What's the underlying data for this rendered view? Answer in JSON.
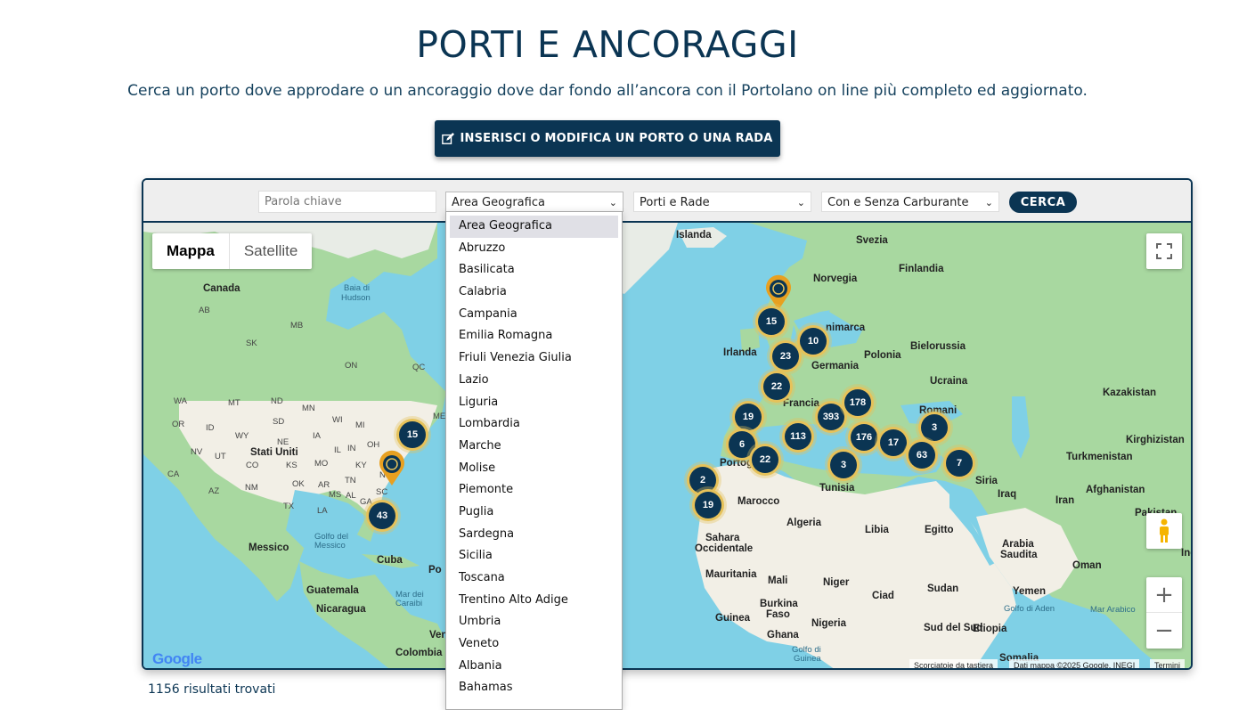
{
  "header": {
    "title": "PORTI E ANCORAGGI",
    "subtitle": "Cerca un porto dove approdare o un ancoraggio dove dar fondo all’ancora con il Portolano on line più completo ed aggiornato.",
    "cta_label": "INSERISCI O MODIFICA UN PORTO O UNA RADA"
  },
  "filters": {
    "keyword_placeholder": "Parola chiave",
    "area_selected": "Area Geografica",
    "porti_selected": "Porti e Rade",
    "carburante_selected": "Con e Senza Carburante",
    "search_label": "CERCA",
    "area_options": [
      "Area Geografica",
      "Abruzzo",
      "Basilicata",
      "Calabria",
      "Campania",
      "Emilia Romagna",
      "Friuli Venezia Giulia",
      "Lazio",
      "Liguria",
      "Lombardia",
      "Marche",
      "Molise",
      "Piemonte",
      "Puglia",
      "Sardegna",
      "Sicilia",
      "Toscana",
      "Trentino Alto Adige",
      "Umbria",
      "Veneto",
      "Albania",
      "Bahamas"
    ]
  },
  "map": {
    "type_map": "Mappa",
    "type_satellite": "Satellite",
    "clusters": [
      "15",
      "10",
      "23",
      "22",
      "19",
      "393",
      "178",
      "6",
      "113",
      "176",
      "17",
      "3",
      "22",
      "63",
      "7",
      "3",
      "2",
      "19",
      "15",
      "43"
    ],
    "labels": {
      "canada": "Canada",
      "baia": "Baia di",
      "hudson": "Hudson",
      "stati_uniti": "Stati Uniti",
      "messico": "Messico",
      "golfo": "Golfo del",
      "messico2": "Messico",
      "cuba": "Cuba",
      "guatemala": "Guatemala",
      "nicaragua": "Nicaragua",
      "mar_dei": "Mar dei",
      "caraibi": "Caraibi",
      "colombia": "Colombia",
      "islanda": "Islanda",
      "svezia": "Svezia",
      "finlandia": "Finlandia",
      "norvegia": "Norvegia",
      "danimarca": "nimarca",
      "irlanda": "Irlanda",
      "bielorussia": "Bielorussia",
      "polonia": "Polonia",
      "germania": "Germania",
      "ucraina": "Ucraina",
      "kazakistan": "Kazakistan",
      "francia": "Francia",
      "romania": "Romani",
      "portogallo": "Portog",
      "kirghizistan": "Kirghizistan",
      "turkmenistan": "Turkmenistan",
      "tunisia": "Tunisia",
      "siria": "Siria",
      "iraq": "Iraq",
      "iran": "Iran",
      "afghanistan": "Afghanistan",
      "pakistan": "Pakistan",
      "marocco": "Marocco",
      "algeria": "Algeria",
      "libia": "Libia",
      "egitto": "Egitto",
      "sahara": "Sahara",
      "occidentale": "Occidentale",
      "arabia": "Arabia",
      "saudita": "Saudita",
      "oman": "Oman",
      "mauritania": "Mauritania",
      "mali": "Mali",
      "niger": "Niger",
      "ciad": "Ciad",
      "sudan": "Sudan",
      "yemen": "Yemen",
      "burkina": "Burkina",
      "faso": "Faso",
      "guinea": "Guinea",
      "nigeria": "Nigeria",
      "ghana": "Ghana",
      "sud_sudan": "Sud del Sud",
      "golfo_aden": "Golfo di Aden",
      "mar_arabico": "Mar Arabico",
      "etiopia": "Etiopia",
      "golfo_guinea": "Golfo di",
      "guinea2": "Guinea",
      "somalia": "Somalia",
      "ven": "Ven",
      "po": "Po",
      "ind": "Ind",
      "ab": "AB",
      "sk": "SK",
      "mb": "MB",
      "on": "ON",
      "qc": "QC",
      "wa": "WA",
      "mt": "MT",
      "nd": "ND",
      "mn": "MN",
      "or": "OR",
      "id": "ID",
      "sd": "SD",
      "wy": "WY",
      "wi": "WI",
      "mi": "MI",
      "me": "ME",
      "ne": "NE",
      "ia": "IA",
      "nv": "NV",
      "ut": "UT",
      "co": "CO",
      "ks": "KS",
      "mo": "MO",
      "il": "IL",
      "in": "IN",
      "oh": "OH",
      "ky": "KY",
      "ca": "CA",
      "az": "AZ",
      "nm": "NM",
      "ok": "OK",
      "ar": "AR",
      "tn": "TN",
      "nc": "NC",
      "sc": "SC",
      "ms": "MS",
      "al": "AL",
      "ga": "GA",
      "tx": "TX",
      "la": "LA",
      "fl": "FL"
    },
    "attribution": {
      "shortcuts": "Scorciatoie da tastiera",
      "data": "Dati mappa ©2025 Google, INEGI",
      "terms": "Termini"
    },
    "logo_text": "Google"
  },
  "results_text": "1156 risultati trovati",
  "colors": {
    "brand": "#0b3553",
    "cluster_ring": "#e6c25a",
    "water": "#7fd0e6"
  }
}
